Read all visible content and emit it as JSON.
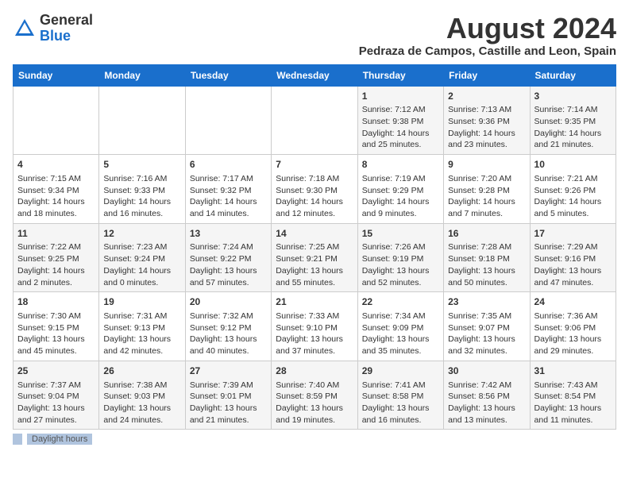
{
  "header": {
    "logo_general": "General",
    "logo_blue": "Blue",
    "month_year": "August 2024",
    "location": "Pedraza de Campos, Castille and Leon, Spain"
  },
  "days_of_week": [
    "Sunday",
    "Monday",
    "Tuesday",
    "Wednesday",
    "Thursday",
    "Friday",
    "Saturday"
  ],
  "weeks": [
    [
      {
        "day": "",
        "sunrise": "",
        "sunset": "",
        "daylight": ""
      },
      {
        "day": "",
        "sunrise": "",
        "sunset": "",
        "daylight": ""
      },
      {
        "day": "",
        "sunrise": "",
        "sunset": "",
        "daylight": ""
      },
      {
        "day": "",
        "sunrise": "",
        "sunset": "",
        "daylight": ""
      },
      {
        "day": "1",
        "sunrise": "Sunrise: 7:12 AM",
        "sunset": "Sunset: 9:38 PM",
        "daylight": "Daylight: 14 hours and 25 minutes."
      },
      {
        "day": "2",
        "sunrise": "Sunrise: 7:13 AM",
        "sunset": "Sunset: 9:36 PM",
        "daylight": "Daylight: 14 hours and 23 minutes."
      },
      {
        "day": "3",
        "sunrise": "Sunrise: 7:14 AM",
        "sunset": "Sunset: 9:35 PM",
        "daylight": "Daylight: 14 hours and 21 minutes."
      }
    ],
    [
      {
        "day": "4",
        "sunrise": "Sunrise: 7:15 AM",
        "sunset": "Sunset: 9:34 PM",
        "daylight": "Daylight: 14 hours and 18 minutes."
      },
      {
        "day": "5",
        "sunrise": "Sunrise: 7:16 AM",
        "sunset": "Sunset: 9:33 PM",
        "daylight": "Daylight: 14 hours and 16 minutes."
      },
      {
        "day": "6",
        "sunrise": "Sunrise: 7:17 AM",
        "sunset": "Sunset: 9:32 PM",
        "daylight": "Daylight: 14 hours and 14 minutes."
      },
      {
        "day": "7",
        "sunrise": "Sunrise: 7:18 AM",
        "sunset": "Sunset: 9:30 PM",
        "daylight": "Daylight: 14 hours and 12 minutes."
      },
      {
        "day": "8",
        "sunrise": "Sunrise: 7:19 AM",
        "sunset": "Sunset: 9:29 PM",
        "daylight": "Daylight: 14 hours and 9 minutes."
      },
      {
        "day": "9",
        "sunrise": "Sunrise: 7:20 AM",
        "sunset": "Sunset: 9:28 PM",
        "daylight": "Daylight: 14 hours and 7 minutes."
      },
      {
        "day": "10",
        "sunrise": "Sunrise: 7:21 AM",
        "sunset": "Sunset: 9:26 PM",
        "daylight": "Daylight: 14 hours and 5 minutes."
      }
    ],
    [
      {
        "day": "11",
        "sunrise": "Sunrise: 7:22 AM",
        "sunset": "Sunset: 9:25 PM",
        "daylight": "Daylight: 14 hours and 2 minutes."
      },
      {
        "day": "12",
        "sunrise": "Sunrise: 7:23 AM",
        "sunset": "Sunset: 9:24 PM",
        "daylight": "Daylight: 14 hours and 0 minutes."
      },
      {
        "day": "13",
        "sunrise": "Sunrise: 7:24 AM",
        "sunset": "Sunset: 9:22 PM",
        "daylight": "Daylight: 13 hours and 57 minutes."
      },
      {
        "day": "14",
        "sunrise": "Sunrise: 7:25 AM",
        "sunset": "Sunset: 9:21 PM",
        "daylight": "Daylight: 13 hours and 55 minutes."
      },
      {
        "day": "15",
        "sunrise": "Sunrise: 7:26 AM",
        "sunset": "Sunset: 9:19 PM",
        "daylight": "Daylight: 13 hours and 52 minutes."
      },
      {
        "day": "16",
        "sunrise": "Sunrise: 7:28 AM",
        "sunset": "Sunset: 9:18 PM",
        "daylight": "Daylight: 13 hours and 50 minutes."
      },
      {
        "day": "17",
        "sunrise": "Sunrise: 7:29 AM",
        "sunset": "Sunset: 9:16 PM",
        "daylight": "Daylight: 13 hours and 47 minutes."
      }
    ],
    [
      {
        "day": "18",
        "sunrise": "Sunrise: 7:30 AM",
        "sunset": "Sunset: 9:15 PM",
        "daylight": "Daylight: 13 hours and 45 minutes."
      },
      {
        "day": "19",
        "sunrise": "Sunrise: 7:31 AM",
        "sunset": "Sunset: 9:13 PM",
        "daylight": "Daylight: 13 hours and 42 minutes."
      },
      {
        "day": "20",
        "sunrise": "Sunrise: 7:32 AM",
        "sunset": "Sunset: 9:12 PM",
        "daylight": "Daylight: 13 hours and 40 minutes."
      },
      {
        "day": "21",
        "sunrise": "Sunrise: 7:33 AM",
        "sunset": "Sunset: 9:10 PM",
        "daylight": "Daylight: 13 hours and 37 minutes."
      },
      {
        "day": "22",
        "sunrise": "Sunrise: 7:34 AM",
        "sunset": "Sunset: 9:09 PM",
        "daylight": "Daylight: 13 hours and 35 minutes."
      },
      {
        "day": "23",
        "sunrise": "Sunrise: 7:35 AM",
        "sunset": "Sunset: 9:07 PM",
        "daylight": "Daylight: 13 hours and 32 minutes."
      },
      {
        "day": "24",
        "sunrise": "Sunrise: 7:36 AM",
        "sunset": "Sunset: 9:06 PM",
        "daylight": "Daylight: 13 hours and 29 minutes."
      }
    ],
    [
      {
        "day": "25",
        "sunrise": "Sunrise: 7:37 AM",
        "sunset": "Sunset: 9:04 PM",
        "daylight": "Daylight: 13 hours and 27 minutes."
      },
      {
        "day": "26",
        "sunrise": "Sunrise: 7:38 AM",
        "sunset": "Sunset: 9:03 PM",
        "daylight": "Daylight: 13 hours and 24 minutes."
      },
      {
        "day": "27",
        "sunrise": "Sunrise: 7:39 AM",
        "sunset": "Sunset: 9:01 PM",
        "daylight": "Daylight: 13 hours and 21 minutes."
      },
      {
        "day": "28",
        "sunrise": "Sunrise: 7:40 AM",
        "sunset": "Sunset: 8:59 PM",
        "daylight": "Daylight: 13 hours and 19 minutes."
      },
      {
        "day": "29",
        "sunrise": "Sunrise: 7:41 AM",
        "sunset": "Sunset: 8:58 PM",
        "daylight": "Daylight: 13 hours and 16 minutes."
      },
      {
        "day": "30",
        "sunrise": "Sunrise: 7:42 AM",
        "sunset": "Sunset: 8:56 PM",
        "daylight": "Daylight: 13 hours and 13 minutes."
      },
      {
        "day": "31",
        "sunrise": "Sunrise: 7:43 AM",
        "sunset": "Sunset: 8:54 PM",
        "daylight": "Daylight: 13 hours and 11 minutes."
      }
    ]
  ],
  "footer": {
    "daylight_label": "Daylight hours"
  }
}
